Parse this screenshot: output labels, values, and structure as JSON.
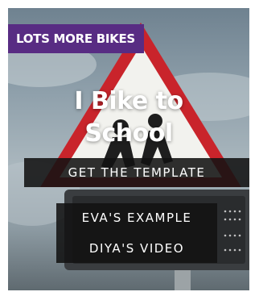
{
  "badge": {
    "label": "LOTS MORE BIKES"
  },
  "title": {
    "line1": "I Bike to",
    "line2": "School"
  },
  "buttons": {
    "template": "GET THE TEMPLATE",
    "eva": "EVA'S EXAMPLE",
    "diya": "DIYA'S VIDEO"
  },
  "colors": {
    "badge": "#582c83",
    "button_bg": "#121212",
    "sign_red": "#c9242b"
  }
}
